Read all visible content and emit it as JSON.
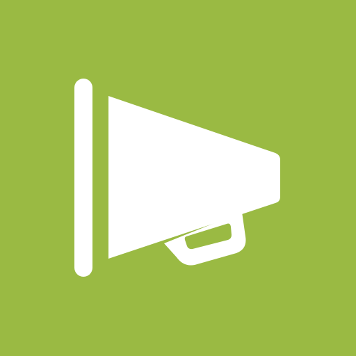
{
  "app_icon": {
    "icon_name": "megaphone-icon",
    "background_color": "#9aba43",
    "glyph_color": "#ffffff"
  }
}
